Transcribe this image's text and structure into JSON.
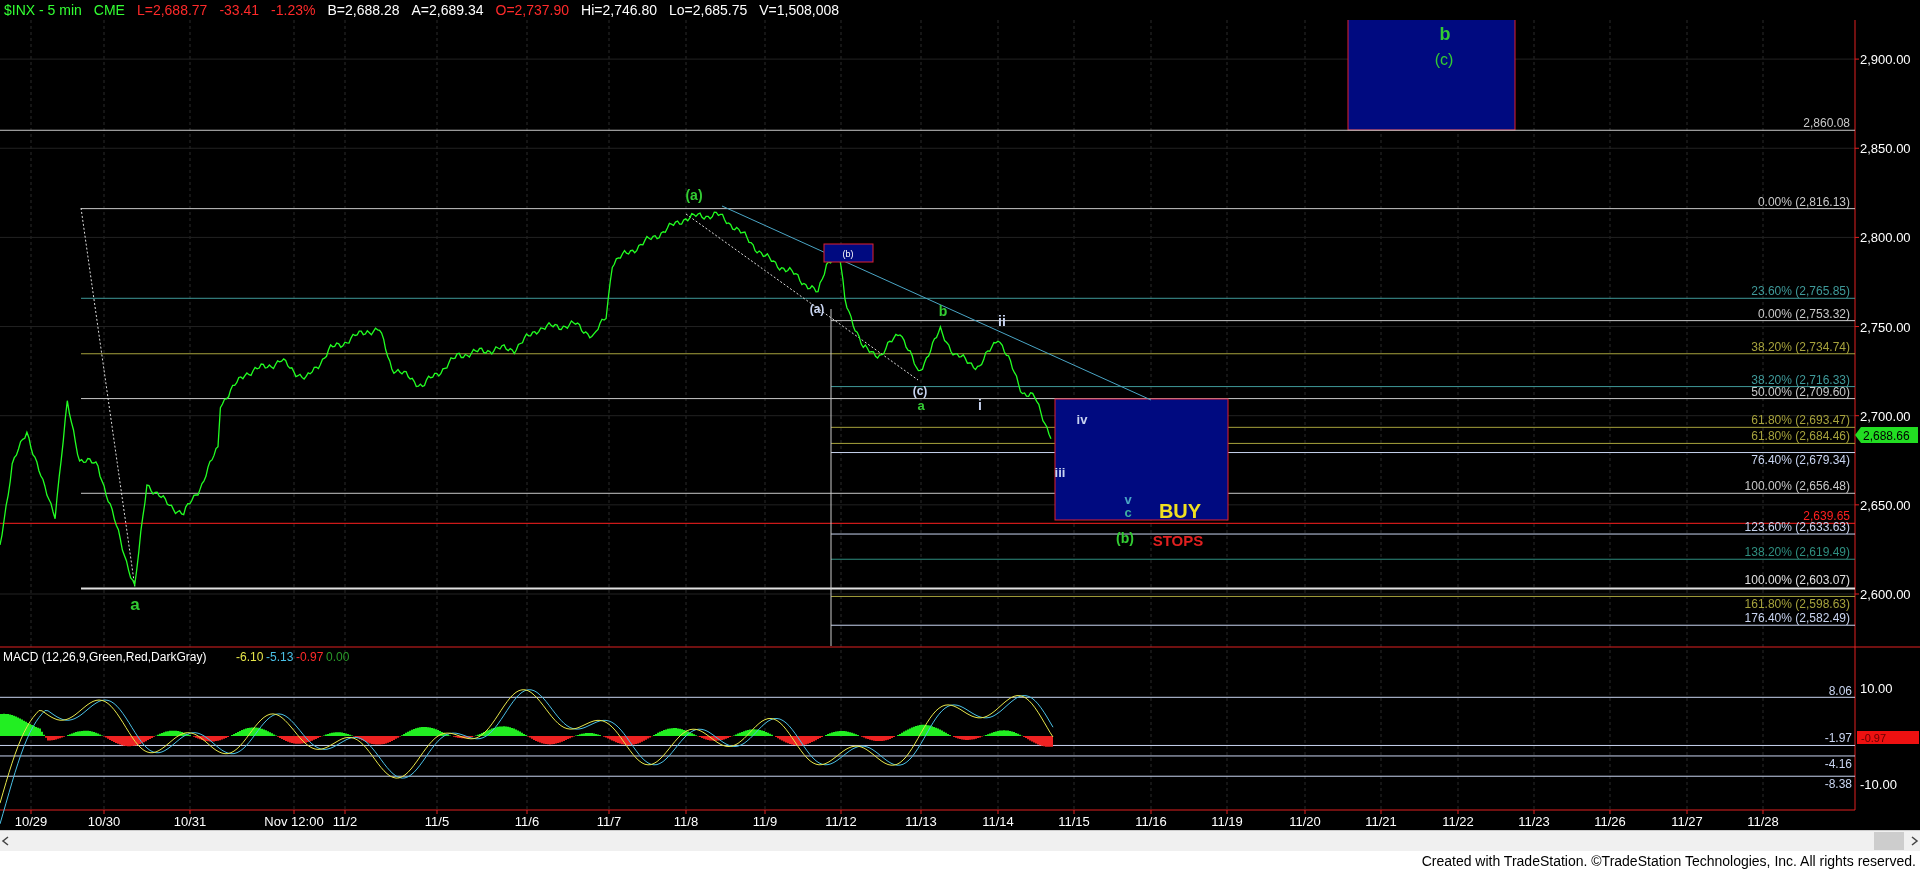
{
  "header": [
    {
      "text": "$INX - 5 min",
      "color": "#33ff33"
    },
    {
      "text": "CME",
      "color": "#33ff33"
    },
    {
      "text": "L=2,688.77",
      "color": "#ff2a2a"
    },
    {
      "text": "-33.41",
      "color": "#ff2a2a"
    },
    {
      "text": "-1.23%",
      "color": "#ff2a2a"
    },
    {
      "text": "B=2,688.28",
      "color": "#ffffff"
    },
    {
      "text": "A=2,689.34",
      "color": "#ffffff"
    },
    {
      "text": "O=2,737.90",
      "color": "#ff2a2a"
    },
    {
      "text": "Hi=2,746.80",
      "color": "#ffffff"
    },
    {
      "text": "Lo=2,685.75",
      "color": "#ffffff"
    },
    {
      "text": "V=1,508,008",
      "color": "#ffffff"
    }
  ],
  "price_axis": {
    "ticks": [
      "2,900.00",
      "2,850.00",
      "2,800.00",
      "2,750.00",
      "2,700.00",
      "2,650.00",
      "2,600.00"
    ],
    "last_price": "2,688.66"
  },
  "price_levels": [
    {
      "label": "2,860.08",
      "color": "#c8c8c8"
    },
    {
      "label": "0.00% (2,816.13)",
      "color": "#c8c8c8"
    },
    {
      "label": "23.60% (2,765.85)",
      "color": "#3f9a9a"
    },
    {
      "label": "0.00% (2,753.32)",
      "color": "#c8c8c8"
    },
    {
      "label": "38.20% (2,734.74)",
      "color": "#a6a23c"
    },
    {
      "label": "38.20% (2,716.33)",
      "color": "#3f9a9a"
    },
    {
      "label": "50.00% (2,709.60)",
      "color": "#c8c8c8"
    },
    {
      "label": "61.80% (2,693.47)",
      "color": "#a6a23c"
    },
    {
      "label": "61.80% (2,684.46)",
      "color": "#a6a23c"
    },
    {
      "label": "76.40% (2,679.34)",
      "color": "#c8d4f0"
    },
    {
      "label": "100.00% (2,656.48)",
      "color": "#c8c8c8"
    },
    {
      "label": "2,639.65",
      "color": "#ff2020"
    },
    {
      "label": "123.60% (2,633.63)",
      "color": "#c8d4f0"
    },
    {
      "label": "138.20% (2,619.49)",
      "color": "#2f8f80"
    },
    {
      "label": "100.00% (2,603.07)",
      "color": "#e0e0e0"
    },
    {
      "label": "161.80% (2,598.63)",
      "color": "#a6a23c"
    },
    {
      "label": "176.40% (2,582.49)",
      "color": "#c8d4f0"
    }
  ],
  "wave_labels": [
    {
      "text": "a",
      "color": "#33cc33"
    },
    {
      "text": "(a)",
      "color": "#33cc33"
    },
    {
      "text": "(a)",
      "color": "#c8d4f0"
    },
    {
      "text": "(c)",
      "color": "#c8d4f0"
    },
    {
      "text": "a",
      "color": "#33cc33"
    },
    {
      "text": "b",
      "color": "#33cc33"
    },
    {
      "text": "ii",
      "color": "#c8d4f0"
    },
    {
      "text": "i",
      "color": "#c8d4f0"
    },
    {
      "text": "iii",
      "color": "#c8d4f0"
    },
    {
      "text": "iv",
      "color": "#c8d4f0"
    },
    {
      "text": "v",
      "color": "#4aa6c6"
    },
    {
      "text": "c",
      "color": "#3fb0a0"
    },
    {
      "text": "(b)",
      "color": "#33cc33"
    }
  ],
  "target_box": {
    "labels": [
      "b",
      "(c)"
    ]
  },
  "small_box": {
    "label": "(b)"
  },
  "buy_box": {
    "label": "BUY"
  },
  "stops_label": "STOPS",
  "macd": {
    "title": "MACD (12,26,9,Green,Red,DarkGray)",
    "values": [
      {
        "text": "-6.10",
        "color": "#e6e64a"
      },
      {
        "text": "-5.13",
        "color": "#4ac0e6"
      },
      {
        "text": "-0.97",
        "color": "#ff2a2a"
      },
      {
        "text": "0.00",
        "color": "#2a9a2a"
      }
    ],
    "levels": [
      "8.06",
      "-1.97",
      "-4.16",
      "-8.38"
    ],
    "ticks": [
      "10.00",
      "-10.00"
    ],
    "last_value": "-0.97"
  },
  "dates": [
    "10/29",
    "10/30",
    "10/31",
    "Nov 12:00",
    "11/2",
    "11/5",
    "11/6",
    "11/7",
    "11/8",
    "11/9",
    "11/12",
    "11/13",
    "11/14",
    "11/15",
    "11/16",
    "11/19",
    "11/20",
    "11/21",
    "11/22",
    "11/23",
    "11/26",
    "11/27",
    "11/28"
  ],
  "footer": "Created with TradeStation. ©TradeStation Technologies, Inc. All rights reserved."
}
